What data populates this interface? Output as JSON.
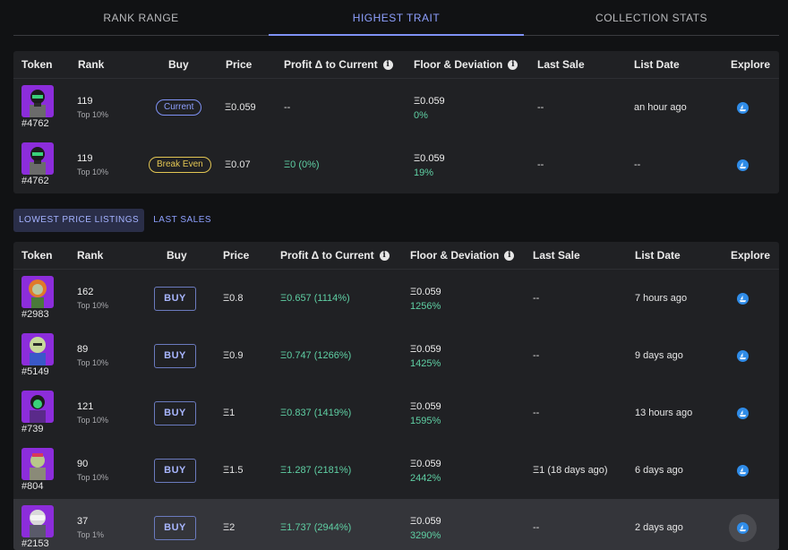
{
  "tabs": [
    "RANK RANGE",
    "HIGHEST TRAIT",
    "COLLECTION STATS"
  ],
  "columns_top": {
    "token": "Token",
    "rank": "Rank",
    "buy": "Buy",
    "price": "Price",
    "profit": "Profit Δ to Current",
    "floor": "Floor & Deviation",
    "last_sale": "Last Sale",
    "list_date": "List Date",
    "explore": "Explore"
  },
  "trait_rows": [
    {
      "token": "#4762",
      "rank": "119",
      "tier": "Top 10%",
      "buy_label": "Current",
      "price": "Ξ0.059",
      "profit": "--",
      "floor": "Ξ0.059",
      "deviation": "0%",
      "last_sale": "--",
      "list_date": "an hour ago"
    },
    {
      "token": "#4762",
      "rank": "119",
      "tier": "Top 10%",
      "buy_label": "Break Even",
      "price": "Ξ0.07",
      "profit": "Ξ0 (0%)",
      "floor": "Ξ0.059",
      "deviation": "19%",
      "last_sale": "--",
      "list_date": "--"
    }
  ],
  "subtabs": [
    "LOWEST PRICE LISTINGS",
    "LAST SALES"
  ],
  "columns_bottom": {
    "token": "Token",
    "rank": "Rank",
    "buy": "Buy",
    "price": "Price",
    "profit": "Profit Δ to Current",
    "floor": "Floor & Deviation",
    "last_sale": "Last Sale",
    "list_date": "List Date",
    "explore": "Explore"
  },
  "listings": [
    {
      "token": "#2983",
      "rank": "162",
      "tier": "Top 10%",
      "buy_label": "BUY",
      "price": "Ξ0.8",
      "profit": "Ξ0.657 (1114%)",
      "floor": "Ξ0.059",
      "deviation": "1256%",
      "last_sale": "--",
      "list_date": "7 hours ago"
    },
    {
      "token": "#5149",
      "rank": "89",
      "tier": "Top 10%",
      "buy_label": "BUY",
      "price": "Ξ0.9",
      "profit": "Ξ0.747 (1266%)",
      "floor": "Ξ0.059",
      "deviation": "1425%",
      "last_sale": "--",
      "list_date": "9 days ago"
    },
    {
      "token": "#739",
      "rank": "121",
      "tier": "Top 10%",
      "buy_label": "BUY",
      "price": "Ξ1",
      "profit": "Ξ0.837 (1419%)",
      "floor": "Ξ0.059",
      "deviation": "1595%",
      "last_sale": "--",
      "list_date": "13 hours ago"
    },
    {
      "token": "#804",
      "rank": "90",
      "tier": "Top 10%",
      "buy_label": "BUY",
      "price": "Ξ1.5",
      "profit": "Ξ1.287 (2181%)",
      "floor": "Ξ0.059",
      "deviation": "2442%",
      "last_sale": "Ξ1 (18 days ago)",
      "list_date": "6 days ago"
    },
    {
      "token": "#2153",
      "rank": "37",
      "tier": "Top 1%",
      "buy_label": "BUY",
      "price": "Ξ2",
      "profit": "Ξ1.737 (2944%)",
      "floor": "Ξ0.059",
      "deviation": "3290%",
      "last_sale": "--",
      "list_date": "2 days ago"
    }
  ],
  "colors": {
    "accent": "#8ea0ff",
    "green": "#5fd0a4",
    "yellow": "#e3c653",
    "explore": "#2f8ce8",
    "thumb_bg": "#8c2ddb"
  },
  "icons": {
    "info": "info-icon",
    "explore": "opensea-boat-icon"
  }
}
